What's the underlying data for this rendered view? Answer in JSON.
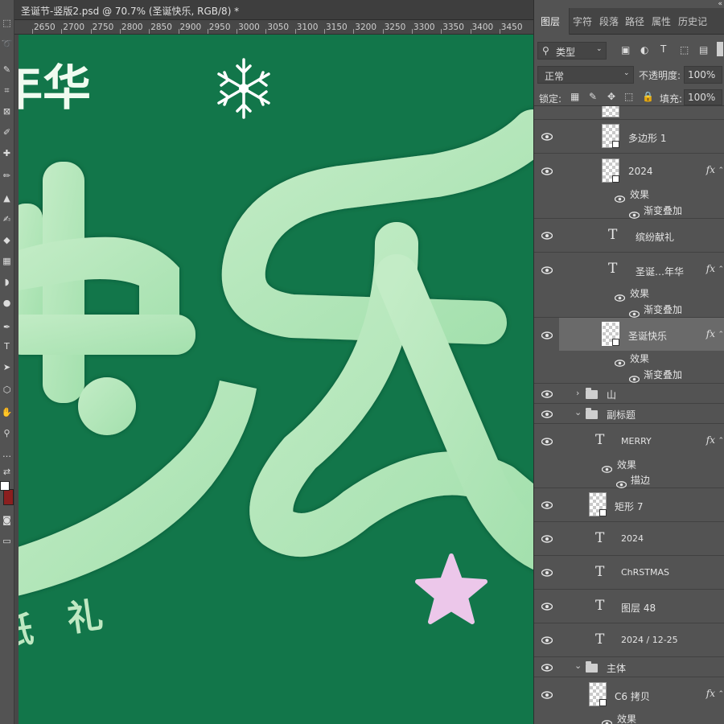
{
  "window": {
    "doc_title": "圣诞节-竖版2.psd @ 70.7% (圣诞快乐, RGB/8) *"
  },
  "ruler": {
    "ticks": [
      "2650",
      "2700",
      "2750",
      "2800",
      "2850",
      "2900",
      "2950",
      "3000",
      "3050",
      "3100",
      "3150",
      "3200",
      "3250",
      "3300",
      "3350",
      "3400",
      "3450"
    ]
  },
  "canvas": {
    "background": "#12764a",
    "text_top": "年华",
    "text_bottom": "礼",
    "text_bottom_left": "纸",
    "big_text": "快乐",
    "letter_fill": "#c6ecc9",
    "star_color": "#ecc7ea",
    "snowflake_color": "#ffffff"
  },
  "panel": {
    "tabs": [
      "图层",
      "字符",
      "段落",
      "路径",
      "属性",
      "历史记"
    ],
    "filter_kind": "类型",
    "blend_mode": "正常",
    "opacity_label": "不透明度:",
    "opacity_value": "100%",
    "lock_label": "锁定:",
    "fill_label": "填充:",
    "fill_value": "100%"
  },
  "layers": {
    "polygon1": "多边形 1",
    "l2024a": "2024",
    "effects": "效果",
    "gradient_overlay": "渐变叠加",
    "stroke": "描边",
    "binfen": "缤纷献礼",
    "shengdan_nianhua": "圣诞…年华",
    "shengdan_kuaile": "圣诞快乐",
    "group_shan": "山",
    "group_fubiaoti": "副标题",
    "merry": "MERRY",
    "rect7": "矩形 7",
    "l2024b": "2024",
    "christmas": "ChRSTMAS",
    "layer48": "图层 48",
    "date": "2024 / 12-25",
    "group_zhuti": "主体",
    "c6copy": "C6 拷贝",
    "fx": "fx"
  },
  "colors": {
    "ui_bg": "#535353",
    "selected_row": "#6a6a6a",
    "swatch_fg": "#ffffff",
    "swatch_bg": "#8b1f1f"
  },
  "icons": {
    "eye": "eye-icon",
    "type_layer": "T",
    "folder": "folder-icon",
    "search": "search-icon"
  }
}
